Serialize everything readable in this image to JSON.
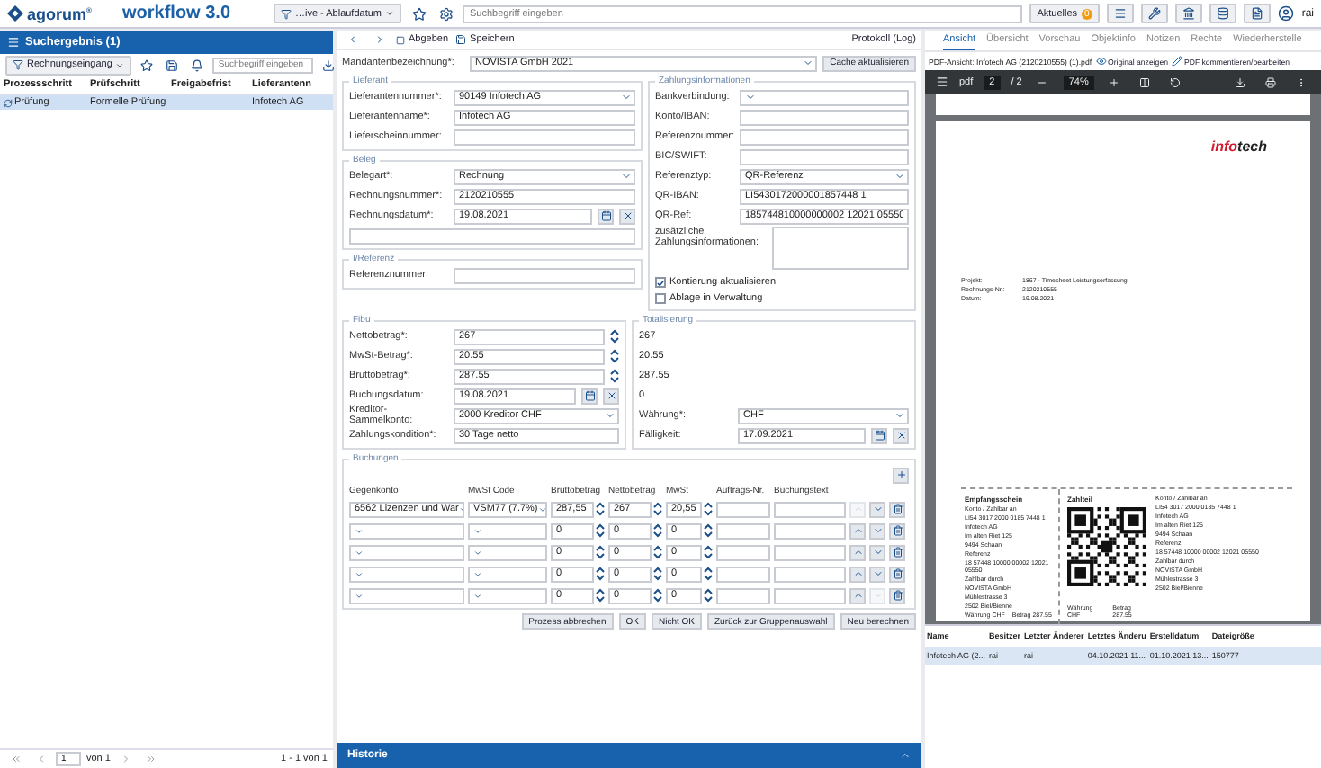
{
  "topbar": {
    "logo": "agorum",
    "logo_mark": "®",
    "app_title": "workflow 3.0",
    "filter": "…ive - Ablaufdatum",
    "search_placeholder": "Suchbegriff eingeben",
    "news": "Aktuelles",
    "news_count": "0",
    "user": "rai"
  },
  "results": {
    "title": "Suchergebnis (1)",
    "filter": "Rechnungseingang",
    "search_placeholder": "Suchbegriff eingeben",
    "columns": [
      "Prozessschritt",
      "Prüfschritt",
      "Freigabefrist",
      "Lieferantenn"
    ],
    "rows": [
      {
        "step": "Prüfung",
        "check": "Formelle Prüfung",
        "supplier": "Infotech AG",
        "selected": true
      }
    ],
    "pager": {
      "page": "1",
      "of": "von 1",
      "summary": "1 - 1 von 1"
    }
  },
  "form": {
    "toolbar": {
      "submit": "Abgeben",
      "save": "Speichern",
      "log": "Protokoll (Log)"
    },
    "client": {
      "label": "Mandantenbezeichnung*:",
      "value": "NOVISTA GmbH 2021",
      "kind": "select"
    },
    "cache_button": "Cache aktualisieren",
    "left_sections": [
      {
        "legend": "Lieferant",
        "fields": [
          {
            "label": "Lieferantennummer*:",
            "value": "90149 Infotech AG",
            "kind": "select"
          },
          {
            "label": "Lieferantenname*:",
            "value": "Infotech AG",
            "kind": "text"
          },
          {
            "label": "Lieferscheinnummer:",
            "kind": "text"
          }
        ]
      },
      {
        "legend": "Beleg",
        "fields": [
          {
            "label": "Belegart*:",
            "value": "Rechnung",
            "kind": "select"
          },
          {
            "label": "Rechnungsnummer*:",
            "value": "2120210555",
            "kind": "text"
          },
          {
            "label": "Rechnungsdatum*:",
            "value": "19.08.2021",
            "kind": "date"
          },
          {
            "kind": "wide"
          }
        ]
      },
      {
        "legend": "I/Referenz",
        "fields": [
          {
            "label": "Referenznummer:",
            "kind": "text"
          }
        ]
      }
    ],
    "payment": {
      "legend": "Zahlungsinformationen",
      "fields": [
        {
          "label": "Bankverbindung:",
          "kind": "select"
        },
        {
          "label": "Konto/IBAN:",
          "kind": "text"
        },
        {
          "label": "Referenznummer:",
          "kind": "text"
        },
        {
          "label": "BIC/SWIFT:",
          "kind": "text"
        },
        {
          "label": "Referenztyp:",
          "value": "QR-Referenz",
          "kind": "select"
        },
        {
          "label": "QR-IBAN:",
          "value": "LI5430172000001857448 1",
          "kind": "text"
        },
        {
          "label": "QR-Ref:",
          "value": "185744810000000002 12021 05550",
          "kind": "text"
        },
        {
          "label": "zusätzliche Zahlungsinformationen:",
          "kind": "textarea"
        }
      ],
      "options": [
        {
          "label": "Kontierung aktualisieren",
          "checked": true
        },
        {
          "label": "Ablage in Verwaltung",
          "checked": false
        }
      ]
    },
    "fibu": {
      "legend": "Fibu",
      "fields": [
        {
          "label": "Nettobetrag*:",
          "value": "267",
          "kind": "number"
        },
        {
          "label": "MwSt-Betrag*:",
          "value": "20.55",
          "kind": "number"
        },
        {
          "label": "Bruttobetrag*:",
          "value": "287.55",
          "kind": "number"
        },
        {
          "label": "Buchungsdatum:",
          "value": "19.08.2021",
          "kind": "date"
        },
        {
          "label": "Kreditor-Sammelkonto:",
          "value": "2000 Kreditor CHF",
          "kind": "select"
        },
        {
          "label": "Zahlungskondition*:",
          "value": "30 Tage netto",
          "kind": "text"
        }
      ]
    },
    "totals": {
      "legend": "Totalisierung",
      "fields": [
        {
          "value": "267",
          "kind": "readonly"
        },
        {
          "value": "20.55",
          "kind": "readonly"
        },
        {
          "value": "287.55",
          "kind": "readonly"
        },
        {
          "value": "0",
          "kind": "readonly"
        },
        {
          "label": "Währung*:",
          "value": "CHF",
          "kind": "select"
        },
        {
          "label": "Fälligkeit:",
          "value": "17.09.2021",
          "kind": "date"
        }
      ]
    },
    "bookings": {
      "legend": "Buchungen",
      "columns": [
        "Gegenkonto",
        "MwSt Code",
        "Bruttobetrag",
        "Nettobetrag",
        "MwSt",
        "Auftrags-Nr.",
        "Buchungstext"
      ],
      "rows": [
        {
          "account": "6562 Lizenzen und War",
          "tax_code": "VSM77 (7.7%)",
          "gross": "287,55",
          "net": "267",
          "tax": "20,55",
          "up_disabled": true,
          "down_disabled": false
        },
        {
          "gross": "0",
          "net": "0",
          "tax": "0",
          "up_disabled": false,
          "down_disabled": false
        },
        {
          "gross": "0",
          "net": "0",
          "tax": "0",
          "up_disabled": false,
          "down_disabled": false
        },
        {
          "gross": "0",
          "net": "0",
          "tax": "0",
          "up_disabled": false,
          "down_disabled": false
        },
        {
          "gross": "0",
          "net": "0",
          "tax": "0",
          "up_disabled": false,
          "down_disabled": true
        }
      ]
    },
    "buttons": [
      "Prozess abbrechen",
      "OK",
      "Nicht OK",
      "Zurück zur Gruppenauswahl",
      "Neu berechnen"
    ],
    "history": "Historie"
  },
  "viewer": {
    "tabs": [
      {
        "label": "Ansicht",
        "selected": true
      },
      {
        "label": "Übersicht",
        "selected": false
      },
      {
        "label": "Vorschau",
        "selected": false
      },
      {
        "label": "Objektinfo",
        "selected": false
      },
      {
        "label": "Notizen",
        "selected": false
      },
      {
        "label": "Rechte",
        "selected": false
      },
      {
        "label": "Wiederherstelle",
        "selected": false
      }
    ],
    "file": "PDF-Ansicht: Infotech AG (2120210555) (1).pdf",
    "original": "Original anzeigen",
    "annotate": "PDF kommentieren/bearbeiten",
    "pdf": {
      "label": "pdf",
      "page": "2",
      "pages": "/ 2",
      "zoom": "74%"
    },
    "document": {
      "logo_accent": "info",
      "logo_rest": "tech",
      "meta": [
        {
          "label": "Projekt:",
          "value": "1867 - Timesheet Leistungserfassung"
        },
        {
          "label": "Rechnungs-Nr.:",
          "value": "2120210555"
        },
        {
          "label": "Datum:",
          "value": "19.08.2021"
        }
      ],
      "receipt_title": "Empfangsschein",
      "receipt_lines": [
        "Konto / Zahlbar an",
        "LI54 3017 2000 0185 7448 1",
        "Infotech AG",
        "Im alten Riet 125",
        "9494 Schaan",
        "Referenz",
        "18 57448 10000 00002 12021 05550",
        "Zahlbar durch",
        "NOVISTA GmbH",
        "Mühlestrasse 3",
        "2502 Biel/Bienne"
      ],
      "receipt_amount": [
        {
          "label": "Währung",
          "value": "CHF"
        },
        {
          "label": "Betrag",
          "value": "287.55"
        }
      ],
      "payment_title": "Zahlteil",
      "payment_lines": [
        "Konto / Zahlbar an",
        "LI54 3017 2000 0185 7448 1",
        "Infotech AG",
        "Im alten Riet 125",
        "9494 Schaan",
        "Referenz",
        "18 57448 10000 00002 12021 05550",
        "Zahlbar durch",
        "NOVISTA GmbH",
        "Mühlestrasse 3",
        "2502 Biel/Bienne"
      ],
      "payment_amount": [
        {
          "label": "Währung",
          "value": "CHF"
        },
        {
          "label": "Betrag",
          "value": "287.55"
        }
      ]
    },
    "table": {
      "columns": [
        "Name",
        "Besitzer",
        "Letzter Änderer",
        "Letztes Änderu",
        "Erstelldatum",
        "Dateigröße"
      ],
      "rows": [
        {
          "cells": [
            "Infotech AG (2...",
            "rai",
            "rai",
            "04.10.2021 11...",
            "01.10.2021 13...",
            "150777"
          ],
          "selected": true
        }
      ]
    }
  }
}
